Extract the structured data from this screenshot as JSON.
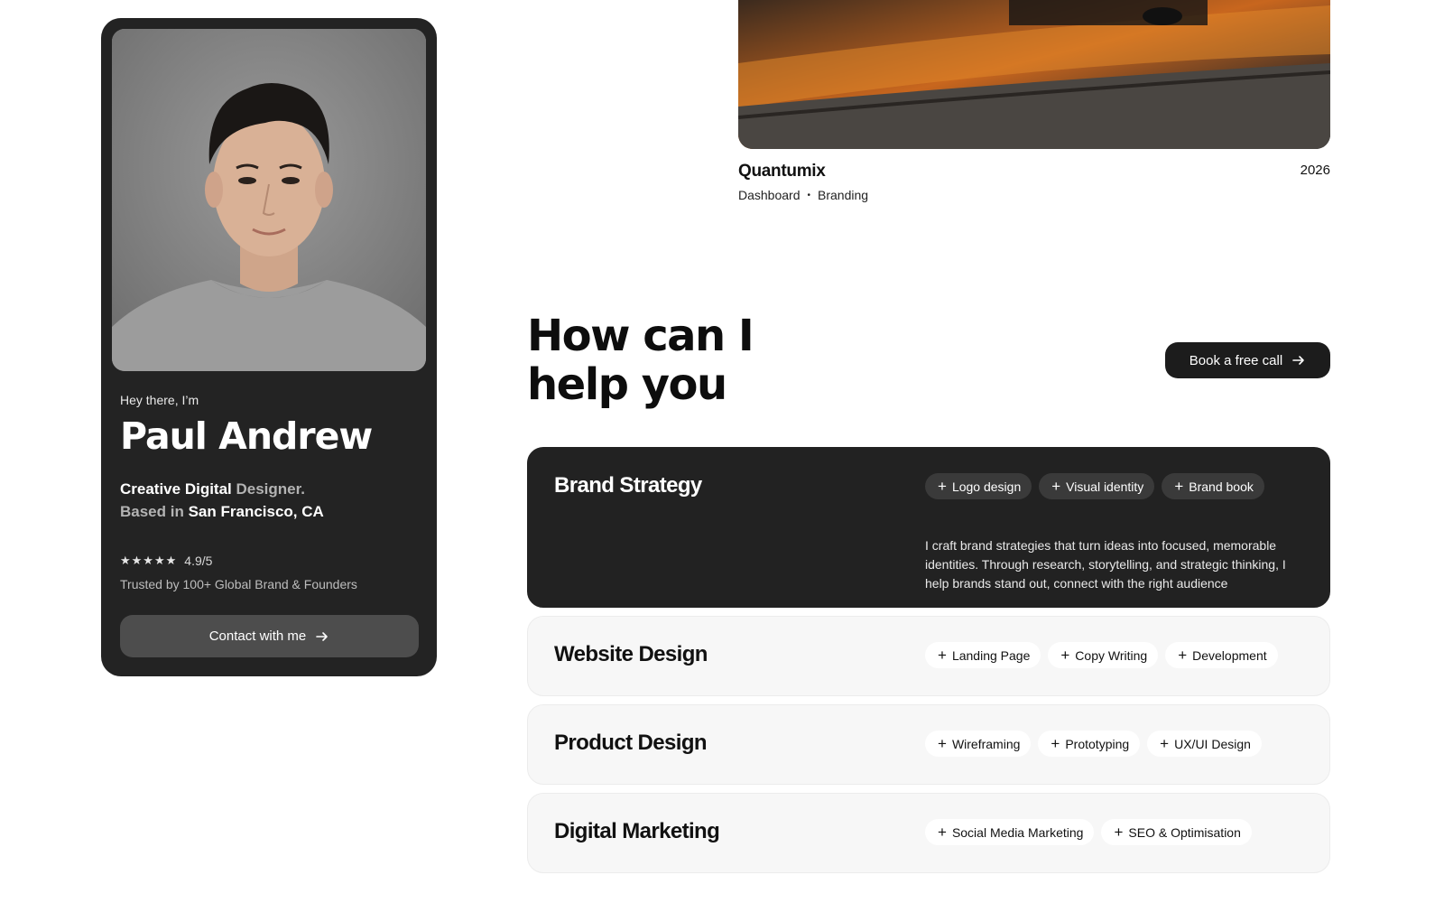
{
  "profile": {
    "greeting": "Hey there, I’m",
    "name": "Paul Andrew",
    "role_a": "Creative Digital",
    "role_b": " Designer.",
    "based_a": "Based in ",
    "based_b": "San Francisco, CA",
    "stars": "★★★★★",
    "rating": "4.9/5",
    "trust": "Trusted by 100+ Global Brand & Founders",
    "contact_label": "Contact with me",
    "contact_icon": "arrow-right-icon"
  },
  "project": {
    "title": "Quantumix",
    "year": "2026",
    "tag_1": "Dashboard",
    "separator": "•",
    "tag_2": "Branding"
  },
  "services_section": {
    "title_line1": "How can I",
    "title_line2": "help you",
    "cta_label": "Book a free call",
    "cta_icon": "arrow-right-icon"
  },
  "services": [
    {
      "name": "Brand Strategy",
      "tags": [
        "Logo design",
        "Visual identity",
        "Brand book"
      ],
      "description": "I craft brand strategies that turn ideas into focused, memorable identities. Through research, storytelling, and strategic thinking, I help brands stand out, connect with the right audience"
    },
    {
      "name": "Website Design",
      "tags": [
        "Landing Page",
        "Copy Writing",
        "Development"
      ]
    },
    {
      "name": "Product Design",
      "tags": [
        "Wireframing",
        "Prototyping",
        "UX/UI Design"
      ]
    },
    {
      "name": "Digital Marketing",
      "tags": [
        "Social Media Marketing",
        "SEO & Optimisation"
      ]
    }
  ],
  "colors": {
    "dark_card": "#232323",
    "accent_dark": "#1c1c1c",
    "service_bg": "#f7f7f7"
  }
}
